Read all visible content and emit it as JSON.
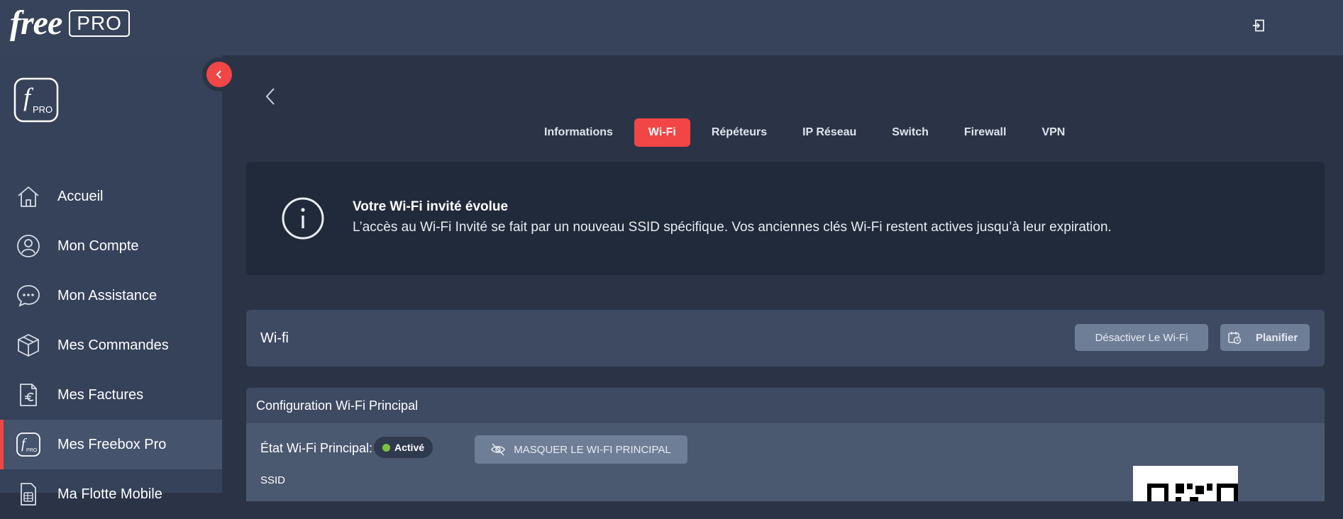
{
  "header": {
    "brand_name": "free",
    "brand_badge": "PRO",
    "logout_icon": "logout-icon"
  },
  "sidebar": {
    "logo_text": "PRO",
    "collapse_icon": "chevron-left-icon",
    "items": [
      {
        "label": "Accueil",
        "icon": "home-icon",
        "active": false
      },
      {
        "label": "Mon Compte",
        "icon": "user-icon",
        "active": false
      },
      {
        "label": "Mon Assistance",
        "icon": "chat-icon",
        "active": false
      },
      {
        "label": "Mes Commandes",
        "icon": "package-icon",
        "active": false
      },
      {
        "label": "Mes Factures",
        "icon": "invoice-euro-icon",
        "active": false
      },
      {
        "label": "Mes Freebox Pro",
        "icon": "freebox-pro-icon",
        "active": true
      },
      {
        "label": "Ma Flotte Mobile",
        "icon": "sim-card-icon",
        "active": false
      }
    ]
  },
  "tabs": [
    {
      "label": "Informations",
      "active": false
    },
    {
      "label": "Wi-Fi",
      "active": true
    },
    {
      "label": "Répéteurs",
      "active": false
    },
    {
      "label": "IP Réseau",
      "active": false
    },
    {
      "label": "Switch",
      "active": false
    },
    {
      "label": "Firewall",
      "active": false
    },
    {
      "label": "VPN",
      "active": false
    }
  ],
  "notice": {
    "title": "Votre Wi-Fi invité évolue",
    "text": "L’accès au Wi-Fi Invité se fait par un nouveau SSID spécifique. Vos anciennes clés Wi-Fi restent actives jusqu’à leur expiration."
  },
  "wifi": {
    "title": "Wi-fi",
    "disable_label": "Désactiver Le Wi-Fi",
    "plan_label": "Planifier"
  },
  "config": {
    "title": "Configuration Wi-Fi Principal",
    "state_label": "État Wi-Fi Principal:",
    "state_value": "Activé",
    "hide_label": "MASQUER LE WI-FI PRINCIPAL",
    "ssid_label": "SSID"
  },
  "colors": {
    "accent": "#f24646",
    "active_green": "#7ac143",
    "header_bg": "#37435a",
    "sidebar_bg": "#36425a",
    "main_bg": "#2b3447"
  }
}
